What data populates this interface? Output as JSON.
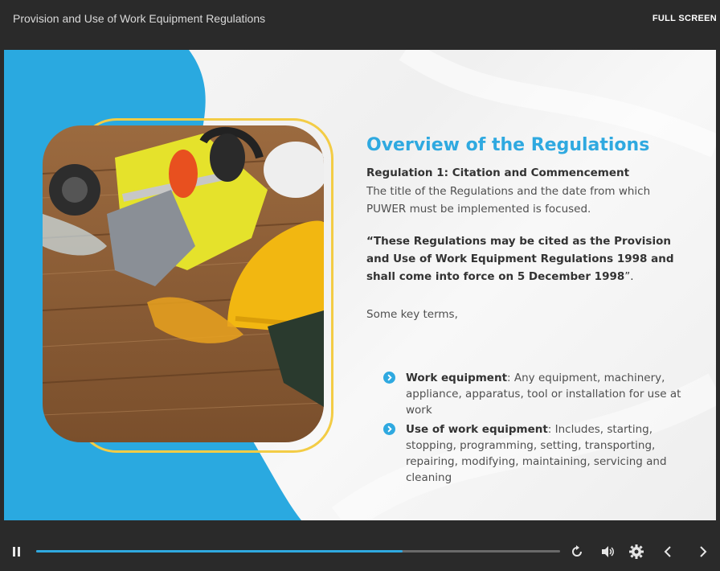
{
  "header": {
    "title": "Provision and Use of Work Equipment Regulations",
    "fullscreen_label": "FULL SCREEN"
  },
  "slide": {
    "heading": "Overview of the Regulations",
    "regulation_title": "Regulation 1: Citation and Commencement",
    "description": "The title of the Regulations and the date from which PUWER must be implemented is focused.",
    "quote_bold": "“These Regulations may be cited as the Provision and Use of Work Equipment Regulations 1998 and shall come into force on 5 December 1998",
    "quote_end": "”.",
    "key_terms_intro": "Some key terms,",
    "key_terms": [
      {
        "term": "Work equipment",
        "definition": ": Any equipment, machinery, appliance, apparatus, tool or installation for use at work"
      },
      {
        "term": "Use of work equipment",
        "definition": ": Includes, starting, stopping, programming, setting, transporting, repairing, modifying, maintaining, servicing and cleaning"
      }
    ],
    "image_subject": "safety gear: hard hat, ear defenders, gloves, goggles, respirator, hi-vis vest on wood"
  },
  "player": {
    "progress_fraction": 0.7,
    "icons": [
      "pause-icon",
      "replay-icon",
      "volume-icon",
      "settings-icon",
      "prev-icon",
      "next-icon"
    ]
  },
  "colors": {
    "accent": "#2fa9e0",
    "frame": "#f3cc45",
    "bar_bg": "#2a2a2a"
  }
}
